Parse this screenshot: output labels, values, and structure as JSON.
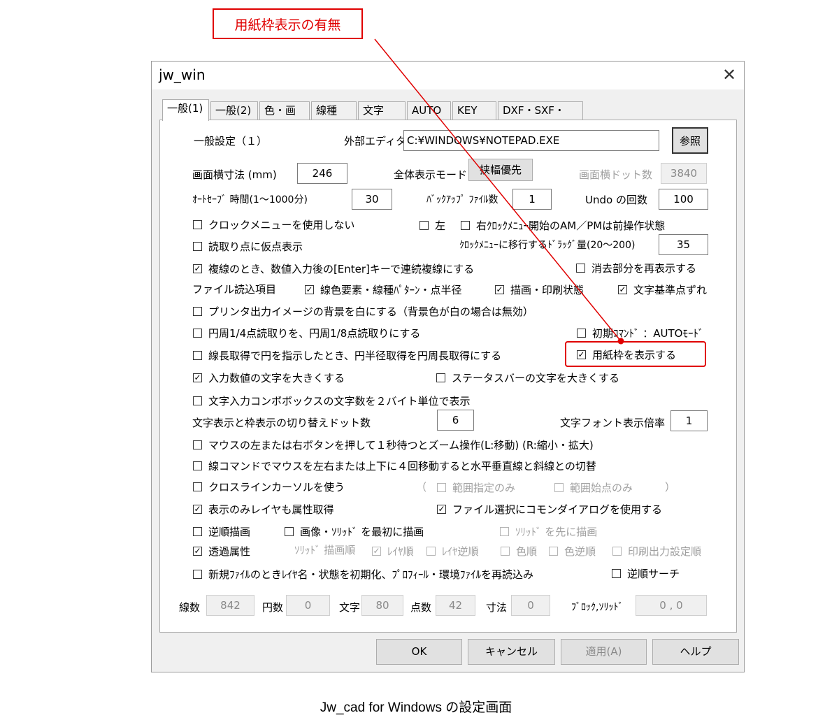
{
  "callout": {
    "text": "用紙枠表示の有無"
  },
  "caption": "Jw_cad for Windows の設定画面",
  "dialog": {
    "title": "jw_win",
    "close_glyph": "✕",
    "tabs": [
      "一般(1)",
      "一般(2)",
      "色・画面",
      "線種",
      "文字",
      "AUTO",
      "KEY",
      "DXF・SXF・JWC"
    ],
    "section_title": "一般設定（１）",
    "external_editor_label": "外部エディタ",
    "external_editor_value": "C:¥WINDOWS¥NOTEPAD.EXE",
    "browse_button": "参照",
    "screen_width_label": "画面横寸法 (mm)",
    "screen_width_value": "246",
    "fullview_mode_label": "全体表示モード",
    "fullview_mode_button": "挟幅優先",
    "screen_dots_label": "画面横ドット数",
    "screen_dots_value": "3840",
    "autosave_label": "ｵｰﾄｾｰﾌﾞ 時間(1〜1000分)",
    "autosave_value": "30",
    "backup_label": "ﾊﾞｯｸｱｯﾌﾟ ﾌｧｲﾙ数",
    "backup_value": "1",
    "undo_label": "Undo の回数",
    "undo_value": "100",
    "clock_menu_disable": "クロックメニューを使用しない",
    "left_label": "左",
    "right_clock_label": "右ｸﾛｯｸﾒﾆｭｰ開始のAM／PMは前操作状態",
    "read_point_label": "読取り点に仮点表示",
    "clock_drag_label": "ｸﾛｯｸﾒﾆｭｰに移行するﾄﾞﾗｯｸﾞ量(20〜200)",
    "clock_drag_value": "35",
    "double_line_label": "複線のとき、数値入力後の[Enter]キーで連続複線にする",
    "erase_redisplay_label": "消去部分を再表示する",
    "file_read_items_label": "ファイル読込項目",
    "file_read_item1": "線色要素・線種ﾊﾟﾀｰﾝ・点半径",
    "file_read_item2": "描画・印刷状態",
    "file_read_item3": "文字基準点ずれ",
    "printer_bg_label": "プリンタ出力イメージの背景を白にする（背景色が白の場合は無効）",
    "circle_read_label": "円周1/4点読取りを、円周1/8点読取りにする",
    "initial_command_label": "初期ｺﾏﾝﾄﾞ ：AUTOﾓｰﾄﾞ",
    "line_length_label": "線長取得で円を指示したとき、円半径取得を円周長取得にする",
    "paper_frame_label": "用紙枠を表示する",
    "big_input_label": "入力数値の文字を大きくする",
    "big_status_label": "ステータスバーの文字を大きくする",
    "combo_2byte_label": "文字入力コンボボックスの文字数を２バイト単位で表示",
    "switch_dots_label": "文字表示と枠表示の切り替えドット数",
    "switch_dots_value": "6",
    "font_scale_label": "文字フォント表示倍率",
    "font_scale_value": "1",
    "mouse_zoom_label": "マウスの左または右ボタンを押して１秒待つとズーム操作(L:移動) (R:縮小・拡大)",
    "line_cmd_label": "線コマンドでマウスを左右または上下に４回移動すると水平垂直線と斜線との切替",
    "crossline_label": "クロスラインカーソルを使う",
    "paren_open": "（",
    "paren_close": "）",
    "range_only_label": "範囲指定のみ",
    "range_start_label": "範囲始点のみ",
    "display_layer_label": "表示のみレイヤも属性取得",
    "common_dialog_label": "ファイル選択にコモンダイアログを使用する",
    "reverse_draw_label": "逆順描画",
    "image_solid_first_label": "画像・ｿﾘｯﾄﾞ を最初に描画",
    "solid_first_label": "ｿﾘｯﾄﾞ を先に描画",
    "transparent_label": "透過属性",
    "solid_order_label": "ｿﾘｯﾄﾞ 描画順",
    "layer_order_label": "ﾚｲﾔ順",
    "layer_reverse_label": "ﾚｲﾔ逆順",
    "color_order_label": "色順",
    "color_reverse_label": "色逆順",
    "print_order_label": "印刷出力設定順",
    "new_file_label": "新規ﾌｧｲﾙのときﾚｲﾔ名・状態を初期化、ﾌﾟﾛﾌｨｰﾙ・環境ﾌｧｲﾙを再読込み",
    "reverse_search_label": "逆順サーチ",
    "stats": {
      "lines_label": "線数",
      "lines_value": "842",
      "circles_label": "円数",
      "circles_value": "0",
      "text_label": "文字",
      "text_value": "80",
      "points_label": "点数",
      "points_value": "42",
      "dims_label": "寸法",
      "dims_value": "0",
      "blocks_label": "ﾌﾞﾛｯｸ,ｿﾘｯﾄﾞ",
      "blocks_value": "0 , 0"
    },
    "buttons": {
      "ok": "OK",
      "cancel": "キャンセル",
      "apply": "適用(A)",
      "help": "ヘルプ"
    },
    "check_glyph": "✓"
  },
  "checked": {
    "clock_menu_disable": false,
    "left": false,
    "right_clock": false,
    "read_point": false,
    "double_line": true,
    "erase_redisplay": false,
    "file_read_item1": true,
    "file_read_item2": true,
    "file_read_item3": true,
    "printer_bg": false,
    "circle_read": false,
    "initial_command": false,
    "line_length": false,
    "paper_frame": true,
    "big_input": true,
    "big_status": false,
    "combo_2byte": false,
    "mouse_zoom": false,
    "line_cmd": false,
    "crossline": false,
    "range_only": false,
    "range_start": false,
    "display_layer": true,
    "common_dialog": true,
    "reverse_draw": false,
    "image_solid_first": false,
    "solid_first": false,
    "transparent": true,
    "layer_order": true,
    "layer_reverse": false,
    "color_order": false,
    "color_reverse": false,
    "print_order": false,
    "new_file": false,
    "reverse_search": false
  },
  "colors": {
    "annotation_red": "#e00000",
    "panel_bg": "#ffffff",
    "dialog_bg": "#f0f0f0"
  }
}
